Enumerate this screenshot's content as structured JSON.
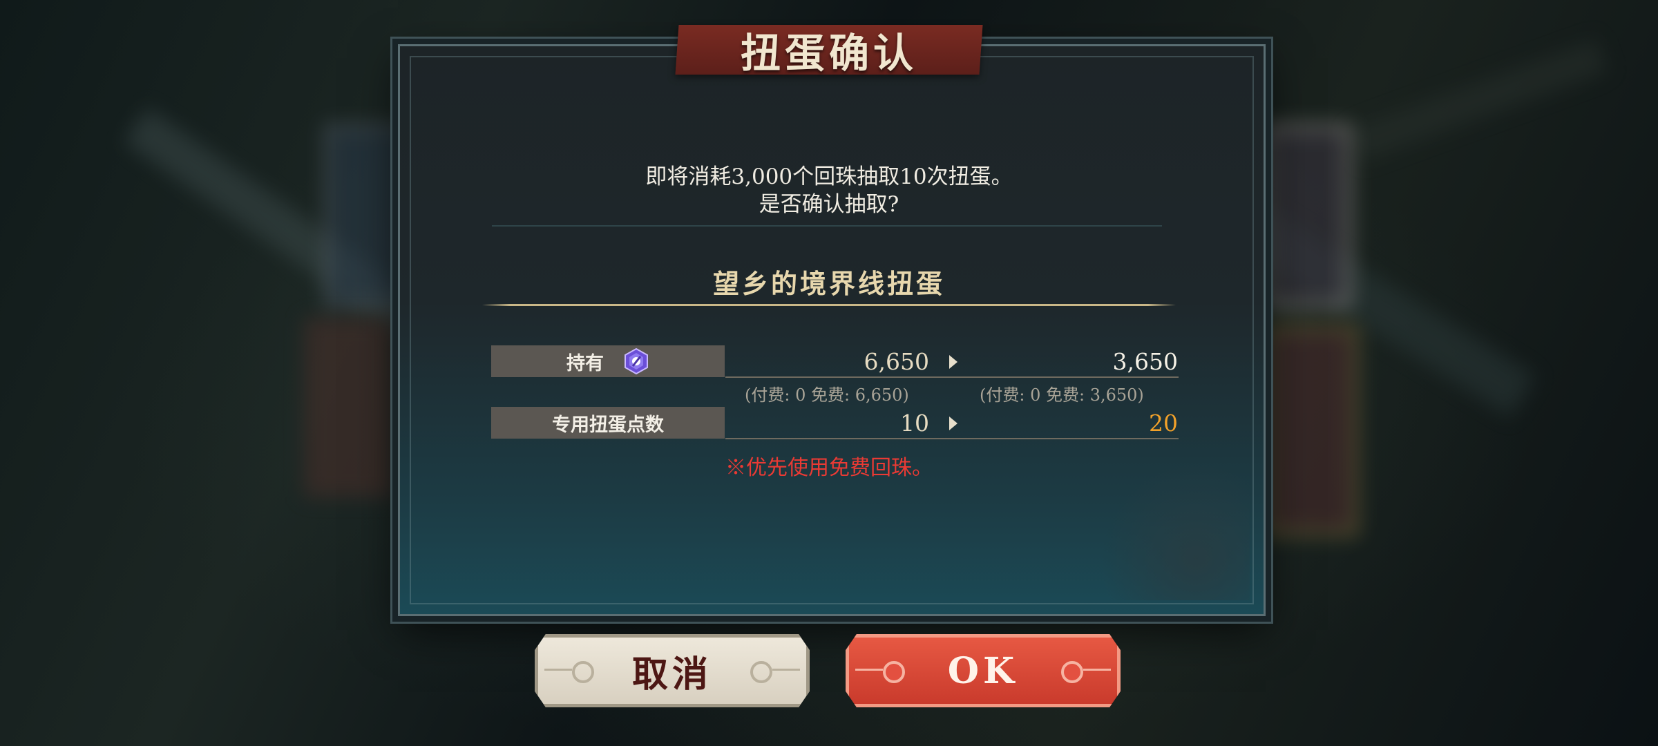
{
  "dialog": {
    "title": "扭蛋确认",
    "message_line1": "即将消耗3,000个回珠抽取10次扭蛋。",
    "message_line2": "是否确认抽取?",
    "gacha_name": "望乡的境界线扭蛋",
    "rows": [
      {
        "label": "持有",
        "icon": "gem-icon",
        "before": "6,650",
        "after": "3,650",
        "before_detail": "(付费: 0   免费: 6,650)",
        "after_detail": "(付费: 0   免费: 3,650)"
      },
      {
        "label": "专用扭蛋点数",
        "before": "10",
        "after": "20"
      }
    ],
    "notice": "※优先使用免费回珠。"
  },
  "buttons": {
    "cancel": "取消",
    "ok": "OK"
  },
  "colors": {
    "notice_red": "#ea3a34",
    "points_after_orange": "#f2a12a",
    "ok_button": "#d9493a",
    "banner": "#6e2620"
  }
}
